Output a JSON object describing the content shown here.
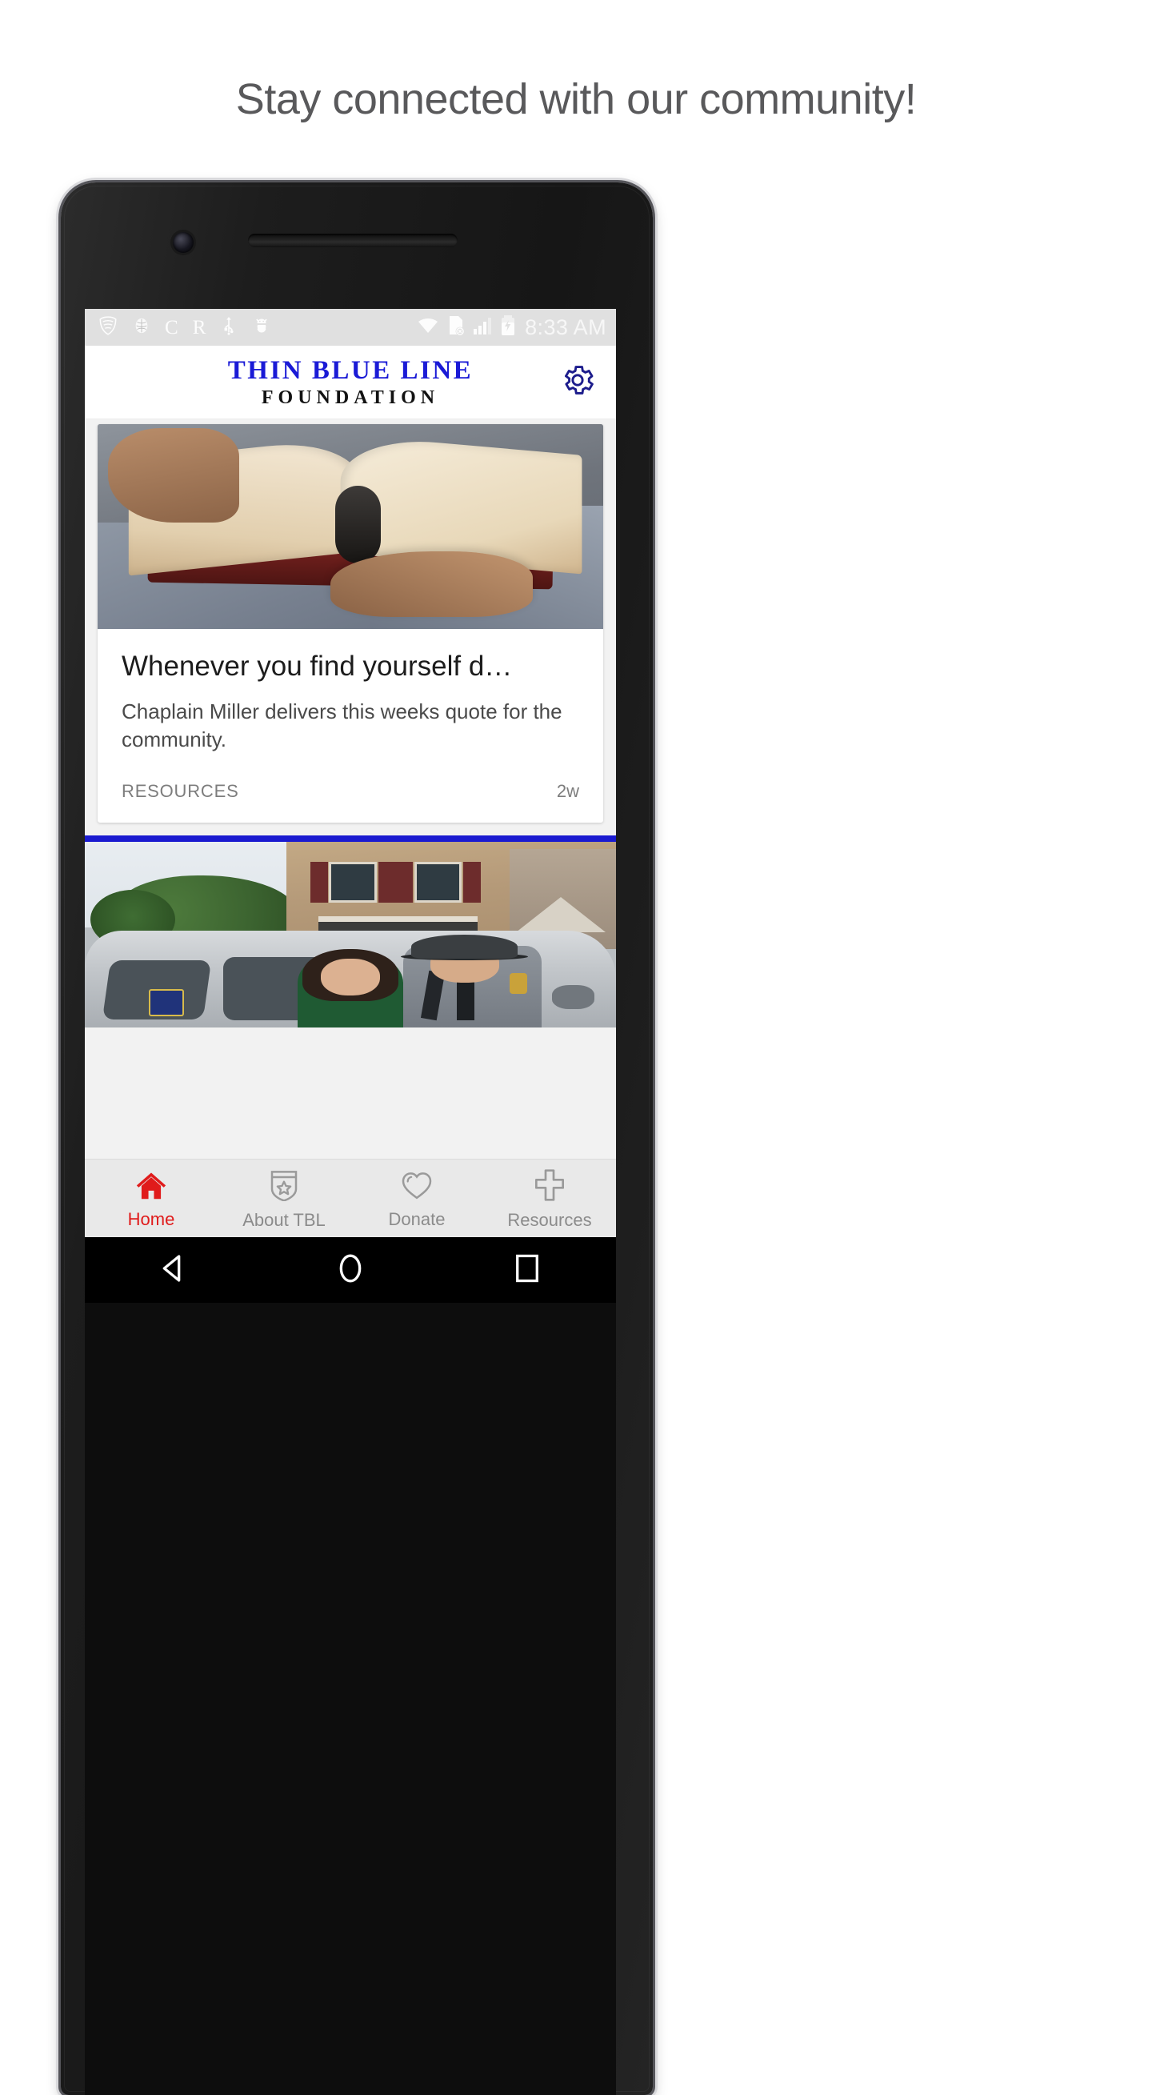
{
  "page": {
    "headline": "Stay connected with our community!"
  },
  "device": {
    "name": "android-phone",
    "camera_icon": "front-camera",
    "speaker_icon": "earpiece-speaker"
  },
  "statusbar": {
    "left_icons": [
      {
        "name": "vpn-shield-icon",
        "glyph": "◔"
      },
      {
        "name": "brain-icon",
        "glyph": "●"
      },
      {
        "name": "letter-c-icon",
        "glyph": "C"
      },
      {
        "name": "letter-r-icon",
        "glyph": "R"
      },
      {
        "name": "usb-icon",
        "glyph": "⑂"
      },
      {
        "name": "android-debug-icon",
        "glyph": "☸"
      }
    ],
    "right_icons": [
      {
        "name": "wifi-icon"
      },
      {
        "name": "no-sim-card-icon"
      },
      {
        "name": "cell-signal-icon"
      },
      {
        "name": "battery-charging-icon"
      }
    ],
    "time": "8:33 AM",
    "bg_color": "#e0e0e0",
    "icon_color": "#ffffff"
  },
  "appbar": {
    "logo_line1": "THIN BLUE LINE",
    "logo_line2": "FOUNDATION",
    "logo_line1_color": "#1a1ad6",
    "logo_line2_color": "#121212",
    "settings_icon": "gear-icon",
    "settings_icon_color": "#1c1c8c"
  },
  "feed": {
    "cards": [
      {
        "image_alt": "hands-holding-open-book",
        "title": "Whenever you find yourself d…",
        "description": "Chaplain Miller delivers this weeks quote for the community.",
        "category": "RESOURCES",
        "age": "2w"
      },
      {
        "image_alt": "state-trooper-and-teen-in-front-of-patrol-suv",
        "divider_color": "#1a1ad0"
      }
    ]
  },
  "tabbar": {
    "active_color": "#e01b1b",
    "inactive_color": "#8b8b8b",
    "tabs": [
      {
        "label": "Home",
        "icon": "home-icon",
        "active": true
      },
      {
        "label": "About TBL",
        "icon": "shield-star-icon",
        "active": false
      },
      {
        "label": "Donate",
        "icon": "heart-icon",
        "active": false
      },
      {
        "label": "Resources",
        "icon": "plus-cross-icon",
        "active": false
      }
    ]
  },
  "navbar": {
    "buttons": [
      {
        "name": "back-button",
        "icon": "back-triangle-icon"
      },
      {
        "name": "home-button",
        "icon": "home-circle-icon"
      },
      {
        "name": "recents-button",
        "icon": "recents-square-icon"
      }
    ]
  }
}
